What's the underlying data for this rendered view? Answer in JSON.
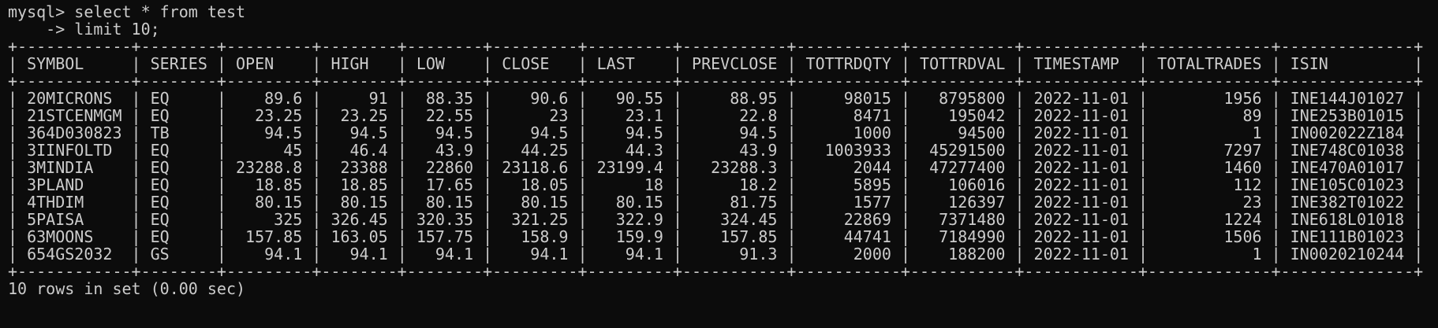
{
  "terminal": {
    "prompt": "mysql> ",
    "command_line1": "select * from test",
    "continuation_prompt": "    -> ",
    "command_line2": "limit 10;",
    "footer": "10 rows in set (0.00 sec)"
  },
  "table": {
    "columns": [
      {
        "label": "SYMBOL",
        "align": "left"
      },
      {
        "label": "SERIES",
        "align": "left"
      },
      {
        "label": "OPEN",
        "align": "right"
      },
      {
        "label": "HIGH",
        "align": "right"
      },
      {
        "label": "LOW",
        "align": "right"
      },
      {
        "label": "CLOSE",
        "align": "right"
      },
      {
        "label": "LAST",
        "align": "right"
      },
      {
        "label": "PREVCLOSE",
        "align": "right"
      },
      {
        "label": "TOTTRDQTY",
        "align": "right"
      },
      {
        "label": "TOTTRDVAL",
        "align": "right"
      },
      {
        "label": "TIMESTAMP",
        "align": "left"
      },
      {
        "label": "TOTALTRADES",
        "align": "right"
      },
      {
        "label": "ISIN",
        "align": "left"
      }
    ],
    "rows": [
      [
        "20MICRONS",
        "EQ",
        "89.6",
        "91",
        "88.35",
        "90.6",
        "90.55",
        "88.95",
        "98015",
        "8795800",
        "2022-11-01",
        "1956",
        "INE144J01027"
      ],
      [
        "21STCENMGM",
        "EQ",
        "23.25",
        "23.25",
        "22.55",
        "23",
        "23.1",
        "22.8",
        "8471",
        "195042",
        "2022-11-01",
        "89",
        "INE253B01015"
      ],
      [
        "364D030823",
        "TB",
        "94.5",
        "94.5",
        "94.5",
        "94.5",
        "94.5",
        "94.5",
        "1000",
        "94500",
        "2022-11-01",
        "1",
        "IN002022Z184"
      ],
      [
        "3IINFOLTD",
        "EQ",
        "45",
        "46.4",
        "43.9",
        "44.25",
        "44.3",
        "43.9",
        "1003933",
        "45291500",
        "2022-11-01",
        "7297",
        "INE748C01038"
      ],
      [
        "3MINDIA",
        "EQ",
        "23288.8",
        "23388",
        "22860",
        "23118.6",
        "23199.4",
        "23288.3",
        "2044",
        "47277400",
        "2022-11-01",
        "1460",
        "INE470A01017"
      ],
      [
        "3PLAND",
        "EQ",
        "18.85",
        "18.85",
        "17.65",
        "18.05",
        "18",
        "18.2",
        "5895",
        "106016",
        "2022-11-01",
        "112",
        "INE105C01023"
      ],
      [
        "4THDIM",
        "EQ",
        "80.15",
        "80.15",
        "80.15",
        "80.15",
        "80.15",
        "81.75",
        "1577",
        "126397",
        "2022-11-01",
        "23",
        "INE382T01022"
      ],
      [
        "5PAISA",
        "EQ",
        "325",
        "326.45",
        "320.35",
        "321.25",
        "322.9",
        "324.45",
        "22869",
        "7371480",
        "2022-11-01",
        "1224",
        "INE618L01018"
      ],
      [
        "63MOONS",
        "EQ",
        "157.85",
        "163.05",
        "157.75",
        "158.9",
        "159.9",
        "157.85",
        "44741",
        "7184990",
        "2022-11-01",
        "1506",
        "INE111B01023"
      ],
      [
        "654GS2032",
        "GS",
        "94.1",
        "94.1",
        "94.1",
        "94.1",
        "94.1",
        "91.3",
        "2000",
        "188200",
        "2022-11-01",
        "1",
        "IN0020210244"
      ]
    ]
  }
}
